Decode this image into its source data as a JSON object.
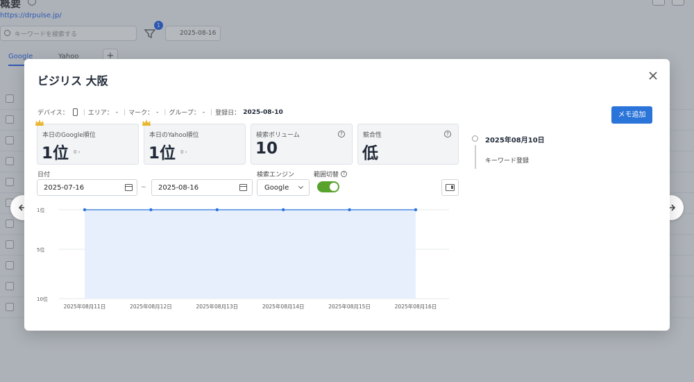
{
  "background": {
    "title": "概要",
    "url": "https://drpulse.jp/",
    "search_placeholder": "キーワードを検索する",
    "filter_badge": "1",
    "date": "2025-08-16",
    "tabs": [
      {
        "label": "Google"
      },
      {
        "label": "Yahoo"
      }
    ],
    "tab_add": "+",
    "row_right_texts": [
      "",
      "",
      "",
      "",
      "",
      "",
      "",
      "",
      "",
      ""
    ]
  },
  "modal": {
    "title": "ビジリス 大阪",
    "meta": {
      "device_label": "デバイス：",
      "area_label": "エリア：",
      "area_value": "-",
      "mark_label": "マーク：",
      "mark_value": "-",
      "group_label": "グループ：",
      "group_value": "-",
      "registered_label": "登録日：",
      "registered_value": "2025-08-10"
    },
    "memo_button": "メモ追加",
    "cards": [
      {
        "label": "本日のGoogle順位",
        "value": "1位",
        "delta": "0 ›"
      },
      {
        "label": "本日のYahoo順位",
        "value": "1位",
        "delta": "0 ›"
      },
      {
        "label": "検索ボリューム",
        "value": "10",
        "help": "?"
      },
      {
        "label": "競合性",
        "value": "低",
        "help": "?"
      }
    ],
    "date_label": "日付",
    "date_from": "2025-07-16",
    "date_to": "2025-08-16",
    "tilde": "~",
    "engine_label": "検索エンジン",
    "engine_value": "Google",
    "range_label": "範囲切替",
    "range_toggle_on": true,
    "timeline": {
      "date": "2025年08月10日",
      "event": "キーワード登録"
    }
  },
  "chart_data": {
    "type": "area",
    "x": [
      "2025年08月11日",
      "2025年08月12日",
      "2025年08月13日",
      "2025年08月14日",
      "2025年08月15日",
      "2025年08月16日"
    ],
    "series": [
      {
        "values": [
          1,
          1,
          1,
          1,
          1,
          1
        ]
      }
    ],
    "y_ticks": [
      "1位",
      "5位",
      "10位"
    ],
    "ylim": [
      1,
      10
    ],
    "y_inverted": true,
    "grid": true,
    "colors": {
      "line": "#2b74d9",
      "fill": "#e8effc"
    }
  }
}
